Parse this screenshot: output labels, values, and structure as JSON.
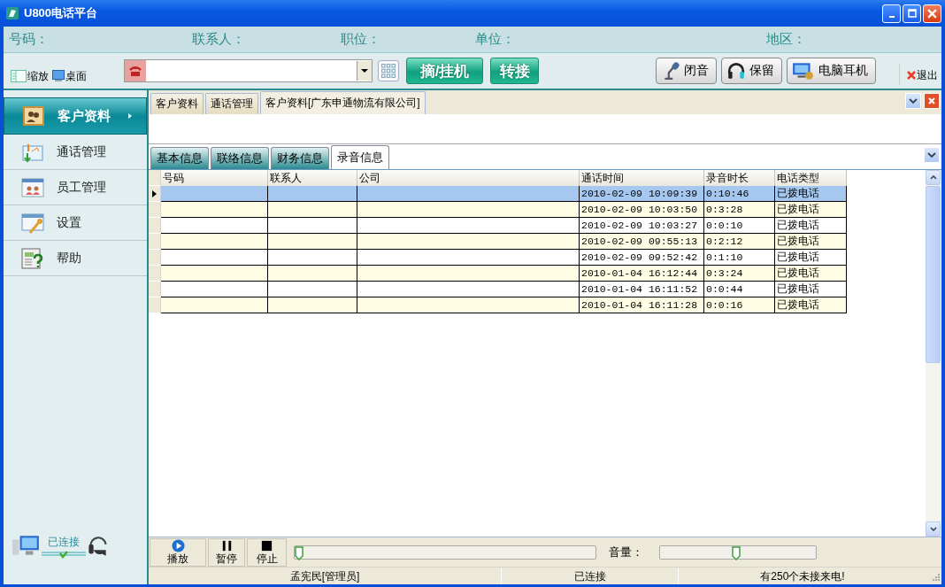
{
  "window": {
    "title": "U800电话平台"
  },
  "info_bar": [
    {
      "label": "号码："
    },
    {
      "label": "联系人："
    },
    {
      "label": "职位："
    },
    {
      "label": "单位："
    },
    {
      "label": "地区："
    }
  ],
  "toolbar": {
    "view_buttons": [
      {
        "label": "缩放",
        "kind": "zoom"
      },
      {
        "label": "桌面",
        "kind": "desktop"
      }
    ],
    "call_buttons": [
      "摘/挂机",
      "转接"
    ],
    "device_buttons": [
      {
        "label": "闭音",
        "kind": "mic"
      },
      {
        "label": "保留",
        "kind": "headphones"
      },
      {
        "label": "电脑耳机",
        "kind": "computer"
      }
    ],
    "exit": "退出"
  },
  "sidebar": {
    "items": [
      {
        "label": "客户资料",
        "kind": "contacts",
        "selected": true
      },
      {
        "label": "通话管理",
        "kind": "calls",
        "selected": false
      },
      {
        "label": "员工管理",
        "kind": "staff",
        "selected": false
      },
      {
        "label": "设置",
        "kind": "settings",
        "selected": false
      },
      {
        "label": "帮助",
        "kind": "help",
        "selected": false
      }
    ],
    "connection": "已连接"
  },
  "doc_tabs": [
    {
      "label": "客户资料",
      "selected": false
    },
    {
      "label": "通话管理",
      "selected": false
    },
    {
      "label": "客户资料[广东申通物流有限公司]",
      "selected": true
    }
  ],
  "sub_tabs": [
    {
      "label": "基本信息",
      "selected": false
    },
    {
      "label": "联络信息",
      "selected": false
    },
    {
      "label": "财务信息",
      "selected": false
    },
    {
      "label": "录音信息",
      "selected": true
    }
  ],
  "table": {
    "columns": [
      "号码",
      "联系人",
      "公司",
      "通话时间",
      "录音时长",
      "电话类型"
    ],
    "rows": [
      {
        "selected": true,
        "time": "2010-02-09 10:09:39",
        "duration": "0:10:46",
        "type": "已拨电话"
      },
      {
        "selected": false,
        "time": "2010-02-09 10:03:50",
        "duration": "0:3:28",
        "type": "已拨电话"
      },
      {
        "selected": false,
        "time": "2010-02-09 10:03:27",
        "duration": "0:0:10",
        "type": "已拨电话"
      },
      {
        "selected": false,
        "time": "2010-02-09 09:55:13",
        "duration": "0:2:12",
        "type": "已拨电话"
      },
      {
        "selected": false,
        "time": "2010-02-09 09:52:42",
        "duration": "0:1:10",
        "type": "已拨电话"
      },
      {
        "selected": false,
        "time": "2010-01-04 16:12:44",
        "duration": "0:3:24",
        "type": "已拨电话"
      },
      {
        "selected": false,
        "time": "2010-01-04 16:11:52",
        "duration": "0:0:44",
        "type": "已拨电话"
      },
      {
        "selected": false,
        "time": "2010-01-04 16:11:28",
        "duration": "0:0:16",
        "type": "已拨电话"
      }
    ]
  },
  "player": {
    "buttons": [
      {
        "label": "播放",
        "kind": "play"
      },
      {
        "label": "暂停",
        "kind": "pause"
      },
      {
        "label": "停止",
        "kind": "stop"
      }
    ],
    "progress": {
      "level": 0
    },
    "volume_label": "音量：",
    "volume": {
      "level": 0.49
    }
  },
  "status_bar": [
    "孟宪民[管理员]",
    "已连接",
    "有250个未接来电!"
  ]
}
